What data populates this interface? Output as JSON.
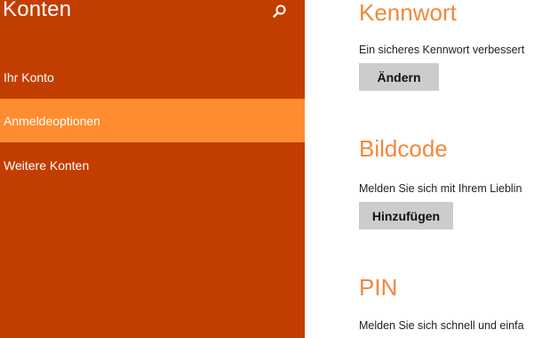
{
  "sidebar": {
    "title": "Konten",
    "search_icon": "search-icon",
    "items": [
      {
        "label": "Ihr Konto",
        "selected": false
      },
      {
        "label": "Anmeldeoptionen",
        "selected": true
      },
      {
        "label": "Weitere Konten",
        "selected": false
      }
    ]
  },
  "main": {
    "sections": [
      {
        "heading": "Kennwort",
        "description": "Ein sicheres Kennwort verbessert",
        "button_label": "Ändern"
      },
      {
        "heading": "Bildcode",
        "description": "Melden Sie sich mit Ihrem Lieblin",
        "button_label": "Hinzufügen"
      },
      {
        "heading": "PIN",
        "description": "Melden Sie sich schnell und einfa"
      }
    ]
  },
  "colors": {
    "sidebar_bg": "#c23e00",
    "selected_bg": "#ff8c2e",
    "heading_accent": "#f2883b",
    "button_bg": "#cccccc"
  }
}
